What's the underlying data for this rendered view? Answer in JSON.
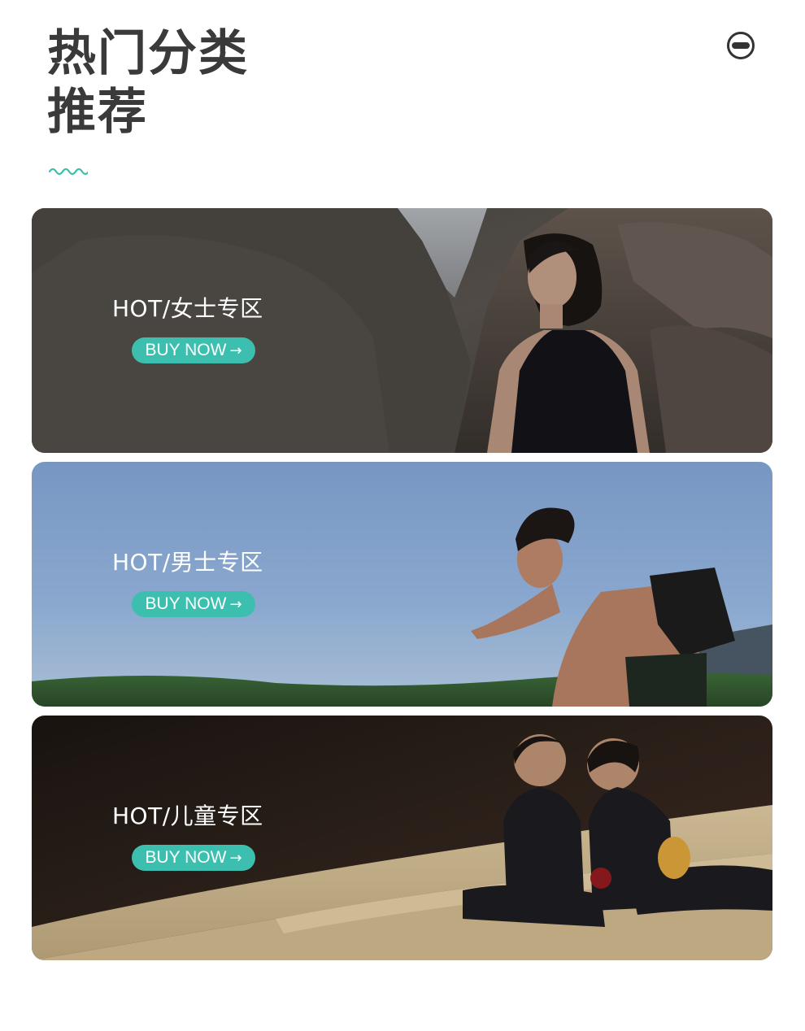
{
  "header": {
    "title_line1": "热门分类",
    "title_line2": "推荐",
    "brand_icon": "goggles-icon",
    "decor_icon": "wave-icon"
  },
  "colors": {
    "accent": "#3cbfae",
    "title": "#3a3a3a"
  },
  "banners": [
    {
      "name": "women",
      "title": "HOT/女士专区",
      "button_label": "BUY NOW",
      "button_icon": "arrow-right-icon"
    },
    {
      "name": "men",
      "title": "HOT/男士专区",
      "button_label": "BUY NOW",
      "button_icon": "arrow-right-icon"
    },
    {
      "name": "kids",
      "title": "HOT/儿童专区",
      "button_label": "BUY NOW",
      "button_icon": "arrow-right-icon"
    }
  ]
}
